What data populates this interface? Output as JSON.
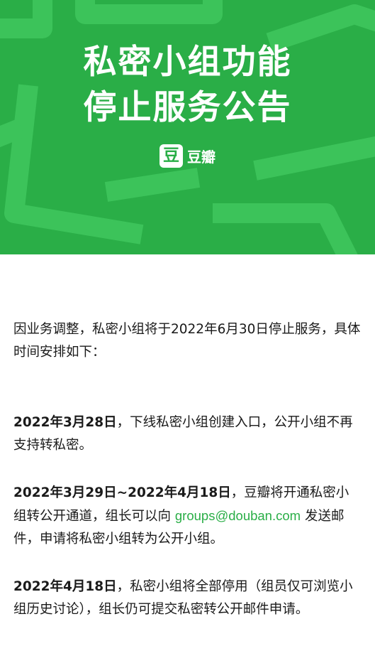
{
  "hero": {
    "title_line1": "私密小组功能",
    "title_line2": "停止服务公告",
    "brand_icon_char": "豆",
    "brand_name": "豆瓣",
    "brand_color": "#2aae47"
  },
  "notice": {
    "intro": "因业务调整，私密小组将于2022年6月30日停止服务，具体时间安排如下：",
    "items": [
      {
        "date": "2022年3月28日",
        "text": "，下线私密小组创建入口，公开小组不再支持转私密。"
      },
      {
        "date": "2022年3月29日~2022年4月18日",
        "text_before": "，豆瓣将开通私密小组转公开通道，组长可以向 ",
        "email": "groups@douban.com",
        "text_after": " 发送邮件，申请将私密小组转为公开小组。"
      },
      {
        "date": "2022年4月18日",
        "text": "，私密小组将全部停用（组员仅可浏览小组历史讨论），组长仍可提交私密转公开邮件申请。"
      }
    ]
  }
}
